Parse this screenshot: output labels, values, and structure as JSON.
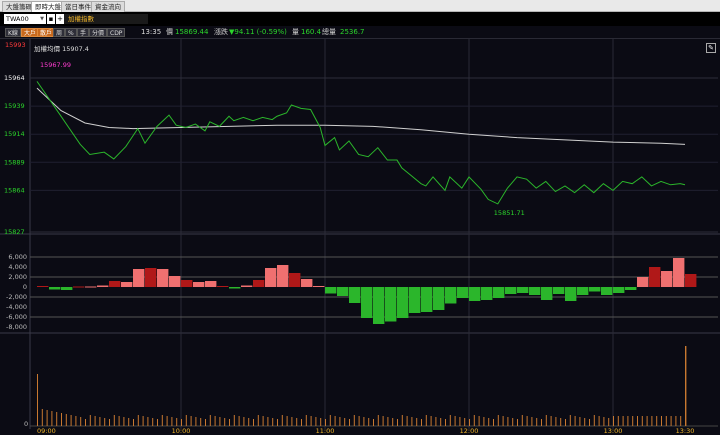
{
  "tabs": [
    "大盤籌碼",
    "即時大盤",
    "當日事件",
    "資金流向"
  ],
  "active_tab_index": 1,
  "symbol": {
    "code": "TWA00",
    "name": "加權指數"
  },
  "toolbar": {
    "buttons": [
      "K線",
      "大戶",
      "散戶",
      "周",
      "%",
      "手",
      "分價",
      "CDP"
    ],
    "time": "13:35",
    "price_label": "價",
    "price": "15869.44",
    "change_label": "漲跌",
    "change": "▼94.11 (-0.59%)",
    "volume_label": "量",
    "volume": "160.4",
    "total_label": "總量",
    "total": "2536.7"
  },
  "colors": {
    "up": "#e04040",
    "down": "#2bb62b",
    "avg": "#d0d0d0",
    "volume": "#c87830",
    "accent": "#f0b52a"
  },
  "chart_data": [
    {
      "type": "line",
      "title": "加權均價 15907.4",
      "price_marker": "15993",
      "open_marker": "15967.99",
      "low_marker": "15851.71",
      "y_ticks": [
        "15964",
        "15939",
        "15914",
        "15889",
        "15864",
        "15827"
      ],
      "x_ticks": [
        "09:00",
        "10:00",
        "11:00",
        "12:00",
        "13:00",
        "13:30"
      ],
      "series": [
        {
          "x": [
            0,
            10,
            18,
            22,
            28,
            32,
            37,
            42,
            45,
            50,
            55,
            58,
            62,
            66,
            70,
            72,
            76,
            80,
            82,
            86,
            90,
            94,
            98,
            100,
            104,
            106,
            110,
            114,
            118,
            120,
            124,
            126,
            130,
            134,
            138,
            142,
            146,
            150,
            152,
            156,
            160,
            162,
            165,
            170,
            172,
            177,
            180,
            185,
            188,
            192,
            196,
            200,
            204,
            208,
            212,
            216,
            220,
            224,
            228,
            232,
            236,
            240,
            244,
            248,
            252,
            256,
            260,
            264,
            268,
            270
          ],
          "values": [
            15961,
            15930,
            15905,
            15896,
            15898,
            15892,
            15903,
            15919,
            15906,
            15921,
            15931,
            15922,
            15920,
            15923,
            15917,
            15925,
            15921,
            15930,
            15926,
            15929,
            15926,
            15929,
            15927,
            15930,
            15933,
            15940,
            15937,
            15936,
            15920,
            15904,
            15911,
            15900,
            15908,
            15896,
            15894,
            15902,
            15891,
            15891,
            15884,
            15877,
            15870,
            15868,
            15876,
            15864,
            15876,
            15866,
            15876,
            15865,
            15856,
            15852,
            15866,
            15876,
            15874,
            15866,
            15872,
            15863,
            15868,
            15862,
            15869,
            15862,
            15870,
            15864,
            15872,
            15870,
            15876,
            15868,
            15872,
            15869,
            15870,
            15869
          ]
        },
        {
          "x": [
            0,
            10,
            20,
            30,
            40,
            60,
            80,
            100,
            110,
            120,
            140,
            160,
            180,
            200,
            220,
            240,
            260,
            270
          ],
          "values": [
            15955,
            15935,
            15924,
            15920,
            15919,
            15920,
            15921,
            15922,
            15922,
            15922,
            15921,
            15918,
            15914,
            15911,
            15909,
            15907,
            15906,
            15905
          ]
        }
      ]
    },
    {
      "type": "bar",
      "y_ticks": [
        "6,000",
        "4,000",
        "2,000",
        "0",
        "-2,000",
        "-4,000",
        "-6,000",
        "-8,000"
      ],
      "x": [
        0,
        5,
        10,
        15,
        20,
        25,
        30,
        35,
        40,
        45,
        50,
        55,
        60,
        65,
        70,
        75,
        80,
        85,
        90,
        95,
        100,
        105,
        110,
        115,
        120,
        125,
        130,
        135,
        140,
        145,
        150,
        155,
        160,
        165,
        170,
        175,
        180,
        185,
        190,
        195,
        200,
        205,
        210,
        215,
        220,
        225,
        230,
        235,
        240,
        245,
        250,
        255,
        260,
        265,
        270
      ],
      "values": [
        200,
        -500,
        -600,
        100,
        100,
        300,
        1200,
        1000,
        3600,
        3800,
        3600,
        2200,
        1400,
        1000,
        1200,
        200,
        -300,
        300,
        1400,
        3800,
        4400,
        2800,
        1600,
        200,
        -1300,
        -1800,
        -3200,
        -6200,
        -7400,
        -6900,
        -6200,
        -5200,
        -5000,
        -4600,
        -3300,
        -2200,
        -2800,
        -2600,
        -2200,
        -1400,
        -1200,
        -1600,
        -2600,
        -1400,
        -2800,
        -1600,
        -900,
        -1600,
        -1200,
        -600,
        2000,
        4000,
        3200,
        5800,
        2600
      ]
    },
    {
      "type": "bar",
      "y_ticks": [
        "0"
      ],
      "x": [
        0,
        270
      ],
      "values": [
        100,
        100
      ]
    }
  ]
}
